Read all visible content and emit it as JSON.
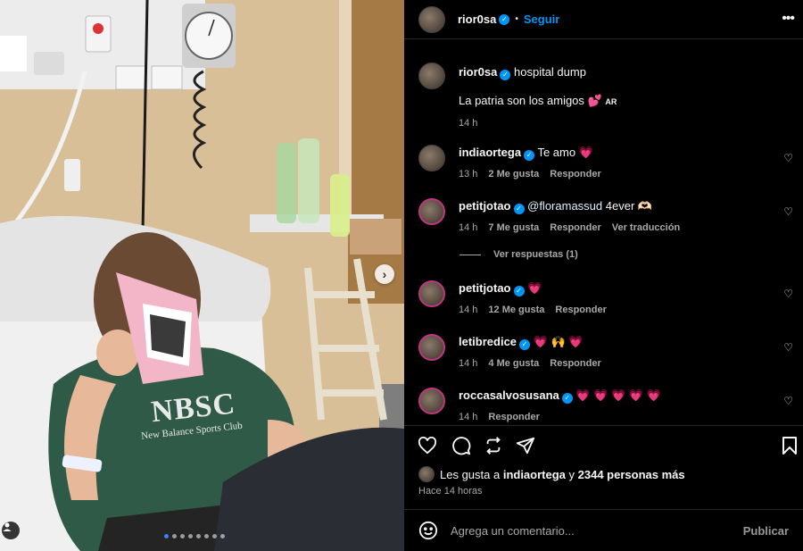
{
  "post": {
    "username": "rior0sa",
    "follow_label": "Seguir",
    "caption_title": "hospital dump",
    "caption_text": "La patria son los amigos 💕",
    "caption_badge": "AR",
    "caption_time": "14 h"
  },
  "photo": {
    "shirt_text_big": "NBSC",
    "shirt_text_small": "New Balance  Sports Club",
    "carousel_count": 8,
    "carousel_active_index": 0
  },
  "comments": [
    {
      "user": "indiaortega",
      "text": "Te amo 💗",
      "time": "13 h",
      "likes": "2 Me gusta",
      "reply": "Responder",
      "translate": ""
    },
    {
      "user": "petitjotao",
      "mention": "@floramassud",
      "text": " 4ever 🫶🏻",
      "time": "14 h",
      "likes": "7 Me gusta",
      "reply": "Responder",
      "translate": "Ver traducción"
    },
    {
      "user": "petitjotao",
      "text": "💗",
      "time": "14 h",
      "likes": "12 Me gusta",
      "reply": "Responder",
      "translate": ""
    },
    {
      "user": "letibredice",
      "text": "💗 🙌 💗",
      "time": "14 h",
      "likes": "4 Me gusta",
      "reply": "Responder",
      "translate": ""
    },
    {
      "user": "roccasalvosusana",
      "text": "💗 💗 💗 💗 💗",
      "time": "14 h",
      "likes": "",
      "reply": "Responder",
      "translate": ""
    }
  ],
  "replies_label": "Ver respuestas (1)",
  "likes": {
    "prefix": "Les gusta a ",
    "user": "indiaortega",
    "middle": " y ",
    "count": "2344 personas más",
    "ago": "Hace 14 horas"
  },
  "composer": {
    "placeholder": "Agrega un comentario...",
    "publish_label": "Publicar"
  },
  "icons": {
    "more": "more-horizontal-icon",
    "like": "heart-icon",
    "comment": "comment-icon",
    "share": "repost-icon",
    "send": "send-icon",
    "save": "bookmark-icon",
    "emoji": "emoji-icon"
  },
  "colors": {
    "accent": "#0095f6",
    "background": "#000000",
    "muted": "#a8a8a8",
    "heart": "#ff3b7f"
  }
}
